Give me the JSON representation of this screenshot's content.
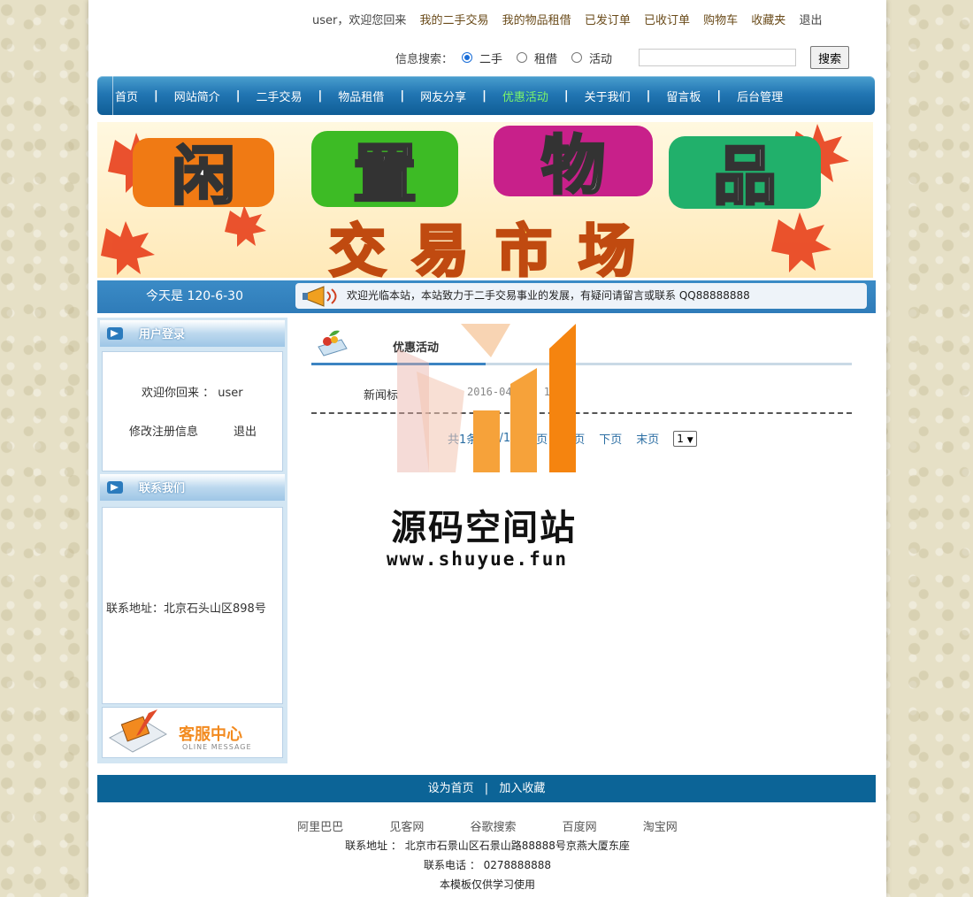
{
  "header": {
    "links": [
      "user，欢迎您回来",
      "我的二手交易",
      "我的物品租借",
      "已发订单",
      "已收订单",
      "购物车",
      "收藏夹",
      "退出"
    ]
  },
  "search": {
    "label": "信息搜索：",
    "options": [
      "二手",
      "租借",
      "活动"
    ],
    "selected": "二手",
    "value": "",
    "button": "搜索"
  },
  "nav": {
    "items": [
      "首页",
      "网站简介",
      "二手交易",
      "物品租借",
      "网友分享",
      "优惠活动",
      "关于我们",
      "留言板",
      "后台管理"
    ],
    "separator": "|",
    "active": "优惠活动",
    "active_color": "#7cf56a"
  },
  "banner": {
    "line1": [
      "闲",
      "置",
      "物",
      "品"
    ],
    "line2": "交易市场"
  },
  "datebar": {
    "date": "今天是 120-6-30",
    "notice": "欢迎光临本站，本站致力于二手交易事业的发展，有疑问请留言或联系 QQ88888888"
  },
  "sidebar": {
    "login_title": "用户登录",
    "welcome": "欢迎你回来 ： user",
    "edit_profile": "修改注册信息",
    "logout": "退出",
    "contact_title": "联系我们",
    "address": "联系地址：北京石头山区898号",
    "service_title": "客服中心",
    "service_sub": "OLINE MESSAGE"
  },
  "main": {
    "title": "优惠活动",
    "news_label": "新闻标",
    "news_date": "2016-04-  15  11",
    "pager": [
      "共1条",
      "1/1",
      "首页",
      "上页",
      "下页",
      "末页"
    ],
    "page_select": "1"
  },
  "watermark": {
    "text": "源码空间站",
    "url": "www.shuyue.fun"
  },
  "footer": {
    "set_home": "设为首页",
    "divider": "|",
    "add_fav": "加入收藏",
    "links": [
      "阿里巴巴",
      "见客网",
      "谷歌搜索",
      "百度网",
      "淘宝网"
    ],
    "address": "联系地址 ： 北京市石景山区石景山路88888号京燕大厦东座",
    "phone": "联系电话 ： 0278888888",
    "note": "本模板仅供学习使用"
  },
  "colors": {
    "nav_blue": "#2276b3",
    "footer_blue": "#0c6497",
    "page_bg": "#e6e0c6"
  }
}
